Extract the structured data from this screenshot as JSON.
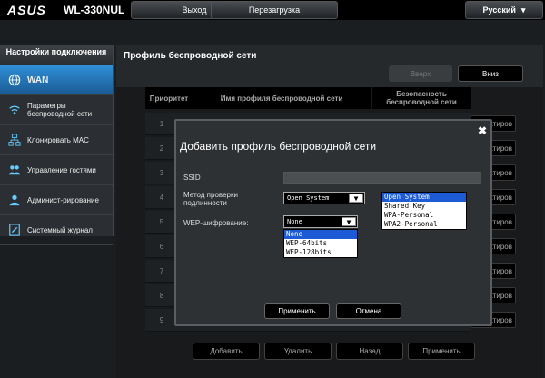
{
  "topbar": {
    "logo": "ASUS",
    "model": "WL-330NUL",
    "logout": "Выход",
    "reboot": "Перезагрузка",
    "language": "Русский"
  },
  "sidebar": {
    "header": "Настройки подключения",
    "items": [
      {
        "label": "WAN",
        "icon": "globe-icon"
      },
      {
        "label": "Параметры беспроводной сети",
        "icon": "wifi-icon"
      },
      {
        "label": "Клонировать MAC",
        "icon": "network-icon"
      },
      {
        "label": "Управление гостями",
        "icon": "users-icon"
      },
      {
        "label": "Админист-рирование",
        "icon": "person-icon"
      },
      {
        "label": "Системный журнал",
        "icon": "log-icon"
      }
    ]
  },
  "main": {
    "title": "Профиль беспроводной сети",
    "up": "Вверх",
    "down": "Вниз",
    "columns": [
      "Приоритет",
      "Имя профиля беспроводной сети",
      "Безопасность беспроводной сети"
    ],
    "rows": [
      "1",
      "2",
      "3",
      "4",
      "5",
      "6",
      "7",
      "8",
      "9"
    ],
    "edit": "Редактиров",
    "actions": {
      "add": "Добавить",
      "delete": "Удалить",
      "back": "Назад",
      "apply": "Применить"
    }
  },
  "modal": {
    "title": "Добавить профиль беспроводной сети",
    "close": "✖",
    "ssid_label": "SSID",
    "ssid_value": "",
    "auth_label": "Метод проверки подлинности",
    "auth_value": "Open System",
    "auth_options": [
      "Open System",
      "Shared Key",
      "WPA-Personal",
      "WPA2-Personal"
    ],
    "wep_label": "WEP-шифрование:",
    "wep_value": "None",
    "wep_options": [
      "None",
      "WEP-64bits",
      "WEP-128bits"
    ],
    "apply": "Применить",
    "cancel": "Отмена"
  }
}
